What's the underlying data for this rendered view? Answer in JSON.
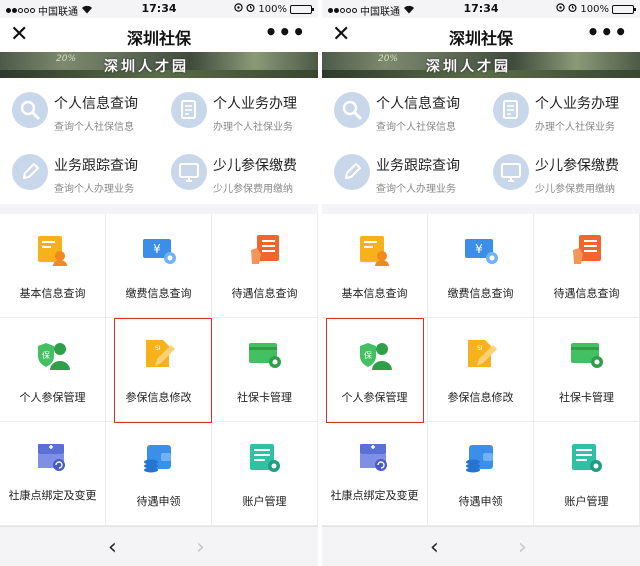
{
  "status": {
    "carrier": "中国联通",
    "time": "17:34",
    "battery": "100%"
  },
  "nav": {
    "title": "深圳社保",
    "close_glyph": "✕",
    "more_glyph": "•••"
  },
  "banner": {
    "text": "深圳人才园",
    "year_text": "20%"
  },
  "quick": [
    {
      "title": "个人信息查询",
      "subtitle": "查询个人社保信息",
      "icon": "magnifier-icon"
    },
    {
      "title": "个人业务办理",
      "subtitle": "办理个人社保业务",
      "icon": "document-icon"
    },
    {
      "title": "业务跟踪查询",
      "subtitle": "查询个人办理业务",
      "icon": "pencil-icon"
    },
    {
      "title": "少儿参保缴费",
      "subtitle": "少儿参保费用缴纳",
      "icon": "monitor-icon"
    }
  ],
  "left_grid": [
    "基本信息查询",
    "缴费信息查询",
    "待遇信息查询",
    "个人参保管理",
    "参保信息修改",
    "社保卡管理",
    "社康点绑定及变更",
    "待遇申领",
    "账户管理"
  ],
  "right_grid": [
    "基本信息查询",
    "缴费信息查询",
    "待遇信息查询",
    "个人参保管理",
    "参保信息修改",
    "社保卡管理",
    "社康点绑定及变更",
    "待遇申领",
    "账户管理"
  ],
  "bottom": {
    "back_glyph": "‹",
    "forward_glyph": "›"
  },
  "colors": {
    "highlight": "#d9302a",
    "yellow": "#f6b21a",
    "blue": "#3b8fe8",
    "orange": "#f2652c",
    "green": "#43c061",
    "teal": "#2fc1a4",
    "icon_circle": "#c9d7ea"
  }
}
